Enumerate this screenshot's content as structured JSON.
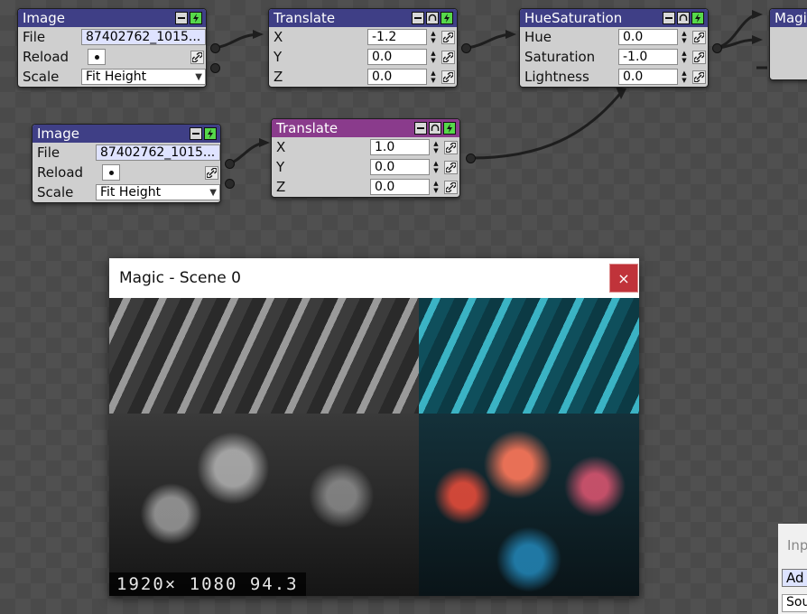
{
  "nodes": {
    "image1": {
      "title": "Image",
      "rows": {
        "file_label": "File",
        "file_value": "87402762_1015...",
        "reload_label": "Reload",
        "scale_label": "Scale",
        "scale_value": "Fit Height"
      }
    },
    "translate1": {
      "title": "Translate",
      "rows": {
        "x_label": "X",
        "x_value": "-1.2",
        "y_label": "Y",
        "y_value": "0.0",
        "z_label": "Z",
        "z_value": "0.0"
      }
    },
    "huesat": {
      "title": "HueSaturation",
      "rows": {
        "hue_label": "Hue",
        "hue_value": "0.0",
        "sat_label": "Saturation",
        "sat_value": "-1.0",
        "light_label": "Lightness",
        "light_value": "0.0"
      }
    },
    "magic": {
      "title": "Magi"
    },
    "image2": {
      "title": "Image",
      "rows": {
        "file_label": "File",
        "file_value": "87402762_1015...",
        "reload_label": "Reload",
        "scale_label": "Scale",
        "scale_value": "Fit Height"
      }
    },
    "translate2": {
      "title": "Translate",
      "rows": {
        "x_label": "X",
        "x_value": "1.0",
        "y_label": "Y",
        "y_value": "0.0",
        "z_label": "Z",
        "z_value": "0.0"
      }
    }
  },
  "viewer": {
    "title": "Magic - Scene 0",
    "close_glyph": "×",
    "stats": "1920× 1080  94.3"
  },
  "side_panel": {
    "input_label": "Inp",
    "add_label": "Ad",
    "source_label": "Sou"
  },
  "colors": {
    "header_blue": "#3f3f86",
    "header_purple": "#8a3b8c",
    "power_green": "#56d84a",
    "close_red": "#c0333a"
  }
}
